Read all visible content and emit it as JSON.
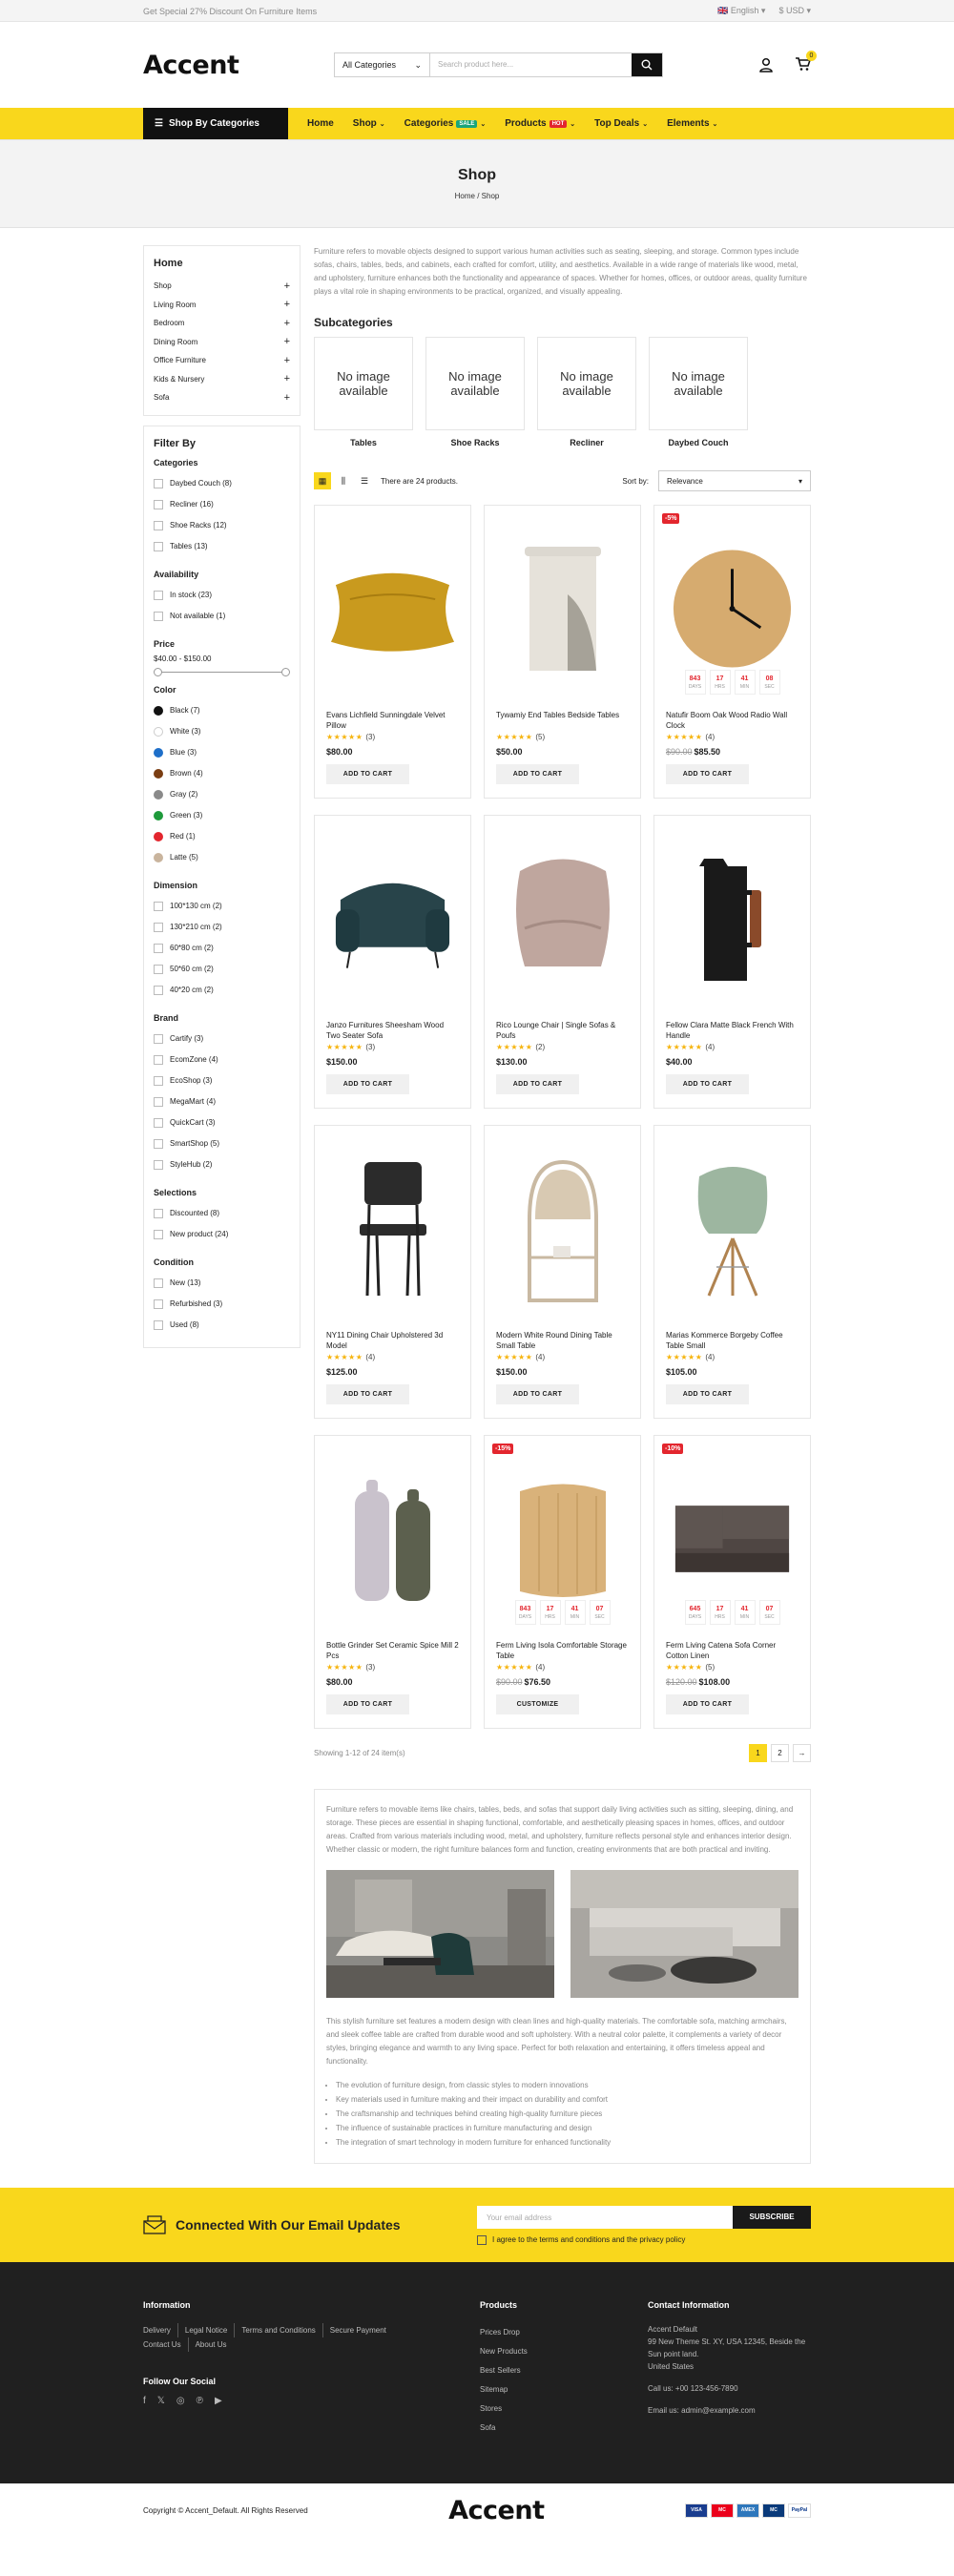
{
  "topbar": {
    "promo": "Get Special 27% Discount On Furniture Items",
    "language": "English",
    "currency": "$ USD"
  },
  "header": {
    "logo": "Accent",
    "category_select": "All Categories",
    "search_placeholder": "Search product here...",
    "cart_count": "0"
  },
  "nav": {
    "shop_by": "Shop By Categories",
    "links": [
      "Home",
      "Shop",
      "Categories",
      "Products",
      "Top Deals",
      "Elements"
    ],
    "sale_badge": "SALE",
    "hot_badge": "HOT"
  },
  "page": {
    "title": "Shop",
    "breadcrumb_home": "Home",
    "breadcrumb_sep": "/",
    "breadcrumb_current": "Shop"
  },
  "sidebar": {
    "home_title": "Home",
    "categories": [
      "Shop",
      "Living Room",
      "Bedroom",
      "Dining Room",
      "Office Furniture",
      "Kids & Nursery",
      "Sofa"
    ],
    "filter_title": "Filter By",
    "cat_title": "Categories",
    "cats": [
      "Daybed Couch (8)",
      "Recliner (16)",
      "Shoe Racks (12)",
      "Tables (13)"
    ],
    "avail_title": "Availability",
    "avail": [
      "In stock (23)",
      "Not available (1)"
    ],
    "price_title": "Price",
    "price_range": "$40.00 - $150.00",
    "color_title": "Color",
    "colors": [
      {
        "label": "Black (7)",
        "hex": "#111111"
      },
      {
        "label": "White (3)",
        "hex": "#ffffff"
      },
      {
        "label": "Blue (3)",
        "hex": "#1e6fc9"
      },
      {
        "label": "Brown (4)",
        "hex": "#7a3d12"
      },
      {
        "label": "Gray (2)",
        "hex": "#8a8a8a"
      },
      {
        "label": "Green (3)",
        "hex": "#1e9a3b"
      },
      {
        "label": "Red (1)",
        "hex": "#e3262e"
      },
      {
        "label": "Latte (5)",
        "hex": "#c9b49d"
      }
    ],
    "dim_title": "Dimension",
    "dims": [
      "100*130 cm (2)",
      "130*210 cm (2)",
      "60*80 cm (2)",
      "50*60 cm (2)",
      "40*20 cm (2)"
    ],
    "brand_title": "Brand",
    "brands": [
      "Cartify (3)",
      "EcomZone (4)",
      "EcoShop (3)",
      "MegaMart (4)",
      "QuickCart (3)",
      "SmartShop (5)",
      "StyleHub (2)"
    ],
    "sel_title": "Selections",
    "sels": [
      "Discounted (8)",
      "New product (24)"
    ],
    "cond_title": "Condition",
    "conds": [
      "New (13)",
      "Refurbished (3)",
      "Used (8)"
    ]
  },
  "content": {
    "description": "Furniture refers to movable objects designed to support various human activities such as seating, sleeping, and storage. Common types include sofas, chairs, tables, beds, and cabinets, each crafted for comfort, utility, and aesthetics. Available in a wide range of materials like wood, metal, and upholstery, furniture enhances both the functionality and appearance of spaces. Whether for homes, offices, or outdoor areas, quality furniture plays a vital role in shaping environments to be practical, organized, and visually appealing.",
    "subcat_title": "Subcategories",
    "no_image": "No image available",
    "subcats": [
      "Tables",
      "Shoe Racks",
      "Recliner",
      "Daybed Couch"
    ],
    "count_text": "There are 24 products.",
    "sort_label": "Sort by:",
    "sort_value": "Relevance",
    "add_to_cart": "ADD TO CART",
    "customize": "CUSTOMIZE",
    "showing": "Showing 1-12 of 24 item(s)",
    "pages": [
      "1",
      "2"
    ]
  },
  "products": [
    {
      "name": "Evans Lichfield Sunningdale Velvet Pillow",
      "stars": "★★★★★",
      "reviews": "(3)",
      "price": "$80.00",
      "old_price": "",
      "discount": "",
      "button": "ADD TO CART",
      "art": "pillow"
    },
    {
      "name": "Tywamiy End Tables Bedside Tables",
      "stars": "★★★★★",
      "reviews": "(5)",
      "price": "$50.00",
      "old_price": "",
      "discount": "",
      "button": "ADD TO CART",
      "art": "table"
    },
    {
      "name": "Natufir Boom Oak Wood Radio Wall Clock",
      "stars": "★★★★★",
      "reviews": "(4)",
      "price": "$85.50",
      "old_price": "$90.00",
      "discount": "-5%",
      "button": "ADD TO CART",
      "art": "clock",
      "timer": [
        "843",
        "17",
        "41",
        "08"
      ]
    },
    {
      "name": "Janzo Furnitures Sheesham Wood Two Seater Sofa",
      "stars": "★★★★★",
      "reviews": "(3)",
      "price": "$150.00",
      "old_price": "",
      "discount": "",
      "button": "ADD TO CART",
      "art": "armchair"
    },
    {
      "name": "Rico Lounge Chair | Single Sofas & Poufs",
      "stars": "★★★★★",
      "reviews": "(2)",
      "price": "$130.00",
      "old_price": "",
      "discount": "",
      "button": "ADD TO CART",
      "art": "lounge"
    },
    {
      "name": "Fellow Clara Matte Black French With Handle",
      "stars": "★★★★★",
      "reviews": "(4)",
      "price": "$40.00",
      "old_price": "",
      "discount": "",
      "button": "ADD TO CART",
      "art": "jug"
    },
    {
      "name": "NY11 Dining Chair Upholstered 3d Model",
      "stars": "★★★★★",
      "reviews": "(4)",
      "price": "$125.00",
      "old_price": "",
      "discount": "",
      "button": "ADD TO CART",
      "art": "chair"
    },
    {
      "name": "Modern White Round Dining Table Small Table",
      "stars": "★★★★★",
      "reviews": "(4)",
      "price": "$150.00",
      "old_price": "",
      "discount": "",
      "button": "ADD TO CART",
      "art": "shelf"
    },
    {
      "name": "Marias Kommerce Borgeby Coffee Table Small",
      "stars": "★★★★★",
      "reviews": "(4)",
      "price": "$105.00",
      "old_price": "",
      "discount": "",
      "button": "ADD TO CART",
      "art": "eames"
    },
    {
      "name": "Bottle Grinder Set Ceramic Spice Mill 2 Pcs",
      "stars": "★★★★★",
      "reviews": "(3)",
      "price": "$80.00",
      "old_price": "",
      "discount": "",
      "button": "ADD TO CART",
      "art": "grinder"
    },
    {
      "name": "Ferm Living Isola Comfortable Storage Table",
      "stars": "★★★★★",
      "reviews": "(4)",
      "price": "$76.50",
      "old_price": "$90.00",
      "discount": "-15%",
      "button": "CUSTOMIZE",
      "art": "stool",
      "timer": [
        "843",
        "17",
        "41",
        "07"
      ]
    },
    {
      "name": "Ferm Living Catena Sofa Corner Cotton Linen",
      "stars": "★★★★★",
      "reviews": "(5)",
      "price": "$108.00",
      "old_price": "$120.00",
      "discount": "-10%",
      "button": "ADD TO CART",
      "art": "corner",
      "timer": [
        "645",
        "17",
        "41",
        "07"
      ]
    }
  ],
  "timer_labels": [
    "DAYS",
    "HRS",
    "MIN",
    "SEC"
  ],
  "long": {
    "p1": "Furniture refers to movable items like chairs, tables, beds, and sofas that support daily living activities such as sitting, sleeping, dining, and storage. These pieces are essential in shaping functional, comfortable, and aesthetically pleasing spaces in homes, offices, and outdoor areas. Crafted from various materials including wood, metal, and upholstery, furniture reflects personal style and enhances interior design. Whether classic or modern, the right furniture balances form and function, creating environments that are both practical and inviting.",
    "p2": "This stylish furniture set features a modern design with clean lines and high-quality materials. The comfortable sofa, matching armchairs, and sleek coffee table are crafted from durable wood and soft upholstery. With a neutral color palette, it complements a variety of decor styles, bringing elegance and warmth to any living space. Perfect for both relaxation and entertaining, it offers timeless appeal and functionality.",
    "list": [
      "The evolution of furniture design, from classic styles to modern innovations",
      "Key materials used in furniture making and their impact on durability and comfort",
      "The craftsmanship and techniques behind creating high-quality furniture pieces",
      "The influence of sustainable practices in furniture manufacturing and design",
      "The integration of smart technology in modern furniture for enhanced functionality"
    ]
  },
  "newsletter": {
    "title": "Connected With Our Email Updates",
    "placeholder": "Your email address",
    "button": "SUBSCRIBE",
    "agree": "I agree to the terms and conditions and the privacy policy"
  },
  "footer": {
    "info_title": "Information",
    "info_links": [
      "Delivery",
      "Legal Notice",
      "Terms and Conditions",
      "Secure Payment",
      "Contact Us",
      "About Us"
    ],
    "social_title": "Follow Our Social",
    "products_title": "Products",
    "products_links": [
      "Prices Drop",
      "New Products",
      "Best Sellers",
      "Sitemap",
      "Stores",
      "Sofa"
    ],
    "contact_title": "Contact Information",
    "contact_lines": [
      "Accent Default",
      "99 New Theme St. XY, USA 12345, Beside the Sun point land.",
      "United States"
    ],
    "call": "Call us: +00 123-456-7890",
    "email": "Email us: admin@example.com"
  },
  "bottom": {
    "copyright": "Copyright © Accent_Default. All Rights Reserved",
    "logo": "Accent",
    "payments": [
      "VISA",
      "MC",
      "AMEX",
      "MC",
      "PayPal"
    ]
  },
  "colors": {
    "accent": "#f9d71c",
    "dark": "#202020",
    "sale": "#e3262e"
  }
}
